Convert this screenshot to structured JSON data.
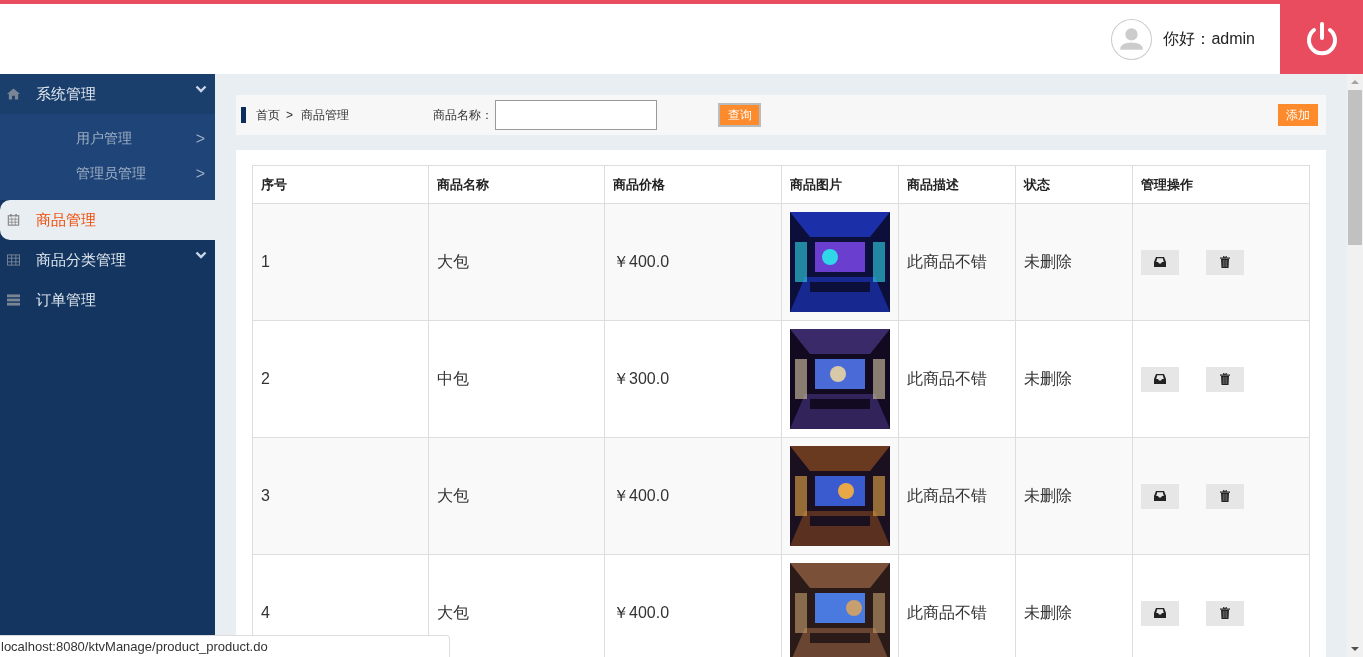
{
  "header": {
    "greeting": "你好：admin"
  },
  "sidebar": {
    "items": [
      {
        "label": "系统管理",
        "kind": "group",
        "selected": false,
        "children": [
          {
            "label": "用户管理",
            "arrow": ">"
          },
          {
            "label": "管理员管理",
            "arrow": ">"
          }
        ]
      },
      {
        "label": "商品管理",
        "kind": "link",
        "selected": true
      },
      {
        "label": "商品分类管理",
        "kind": "group",
        "selected": false
      },
      {
        "label": "订单管理",
        "kind": "link",
        "selected": false
      }
    ]
  },
  "toolbar": {
    "breadcrumb": [
      "首页",
      "商品管理"
    ],
    "separator": ">",
    "search_label": "商品名称：",
    "search_button": "查询",
    "add_button": "添加"
  },
  "table": {
    "columns": [
      "序号",
      "商品名称",
      "商品价格",
      "商品图片",
      "商品描述",
      "状态",
      "管理操作"
    ],
    "rows": [
      {
        "number": "1",
        "name": "大包",
        "price": "￥400.0",
        "description": "此商品不错",
        "status": "未删除"
      },
      {
        "number": "2",
        "name": "中包",
        "price": "￥300.0",
        "description": "此商品不错",
        "status": "未删除"
      },
      {
        "number": "3",
        "name": "大包",
        "price": "￥400.0",
        "description": "此商品不错",
        "status": "未删除"
      },
      {
        "number": "4",
        "name": "大包",
        "price": "￥400.0",
        "description": "此商品不错",
        "status": "未删除"
      }
    ]
  },
  "status_bar": "localhost:8080/ktvManage/product_product.do"
}
